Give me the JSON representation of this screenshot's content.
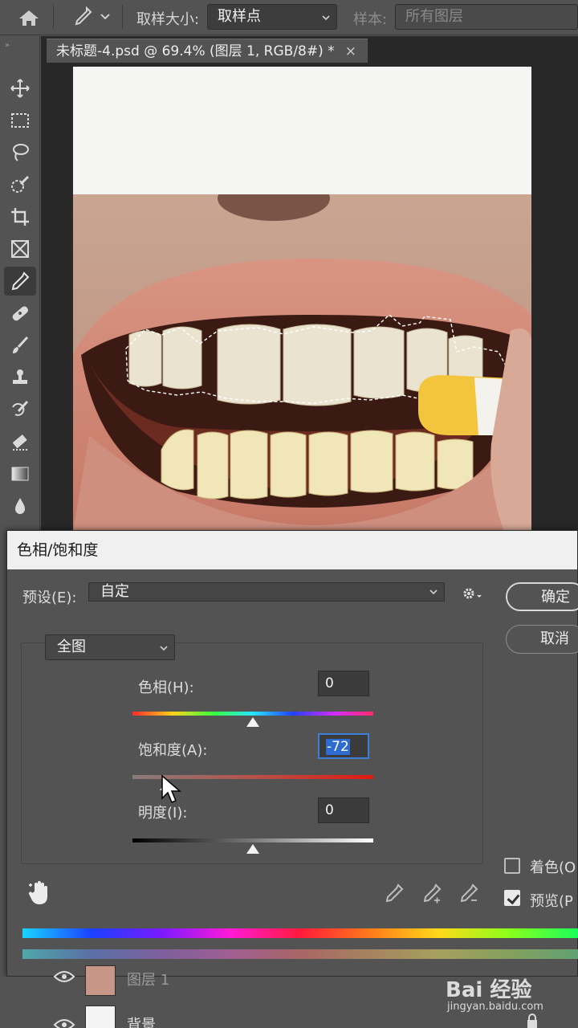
{
  "options_bar": {
    "sample_size_label": "取样大小:",
    "sample_size_value": "取样点",
    "sample_label": "样本:",
    "sample_value": "所有图层"
  },
  "document_tab": {
    "title": "未标题-4.psd @ 69.4% (图层 1, RGB/8#) *",
    "close": "×"
  },
  "toolbar": {
    "grip": "»",
    "tools": [
      "move-tool",
      "marquee-tool",
      "lasso-tool",
      "quick-selection-tool",
      "crop-tool",
      "frame-tool",
      "eyedropper-tool",
      "healing-brush-tool",
      "brush-tool",
      "clone-stamp-tool",
      "history-brush-tool",
      "eraser-tool",
      "gradient-tool",
      "blur-tool"
    ],
    "active_tool": "eyedropper-tool"
  },
  "dialog": {
    "title": "色相/饱和度",
    "preset_label": "预设(E):",
    "preset_value": "自定",
    "ok_label": "确定",
    "cancel_label": "取消",
    "channel_value": "全图",
    "hue_label": "色相(H):",
    "hue_value": "0",
    "saturation_label": "饱和度(A):",
    "saturation_value": "-72",
    "lightness_label": "明度(I):",
    "lightness_value": "0",
    "colorize_label": "着色(O",
    "colorize_checked": false,
    "preview_label": "预览(P",
    "preview_checked": true,
    "hue_range": [
      -180,
      180
    ],
    "saturation_range": [
      -100,
      100
    ],
    "lightness_range": [
      -100,
      100
    ]
  },
  "layers": {
    "layer1_name": "图层 1",
    "background_name": "背景"
  },
  "watermark": {
    "main": "Bai 经验",
    "sub": "jingyan.baidu.com"
  },
  "colors": {
    "panel": "#535353",
    "canvas_bg": "#282828",
    "focus": "#3c7fd6"
  }
}
